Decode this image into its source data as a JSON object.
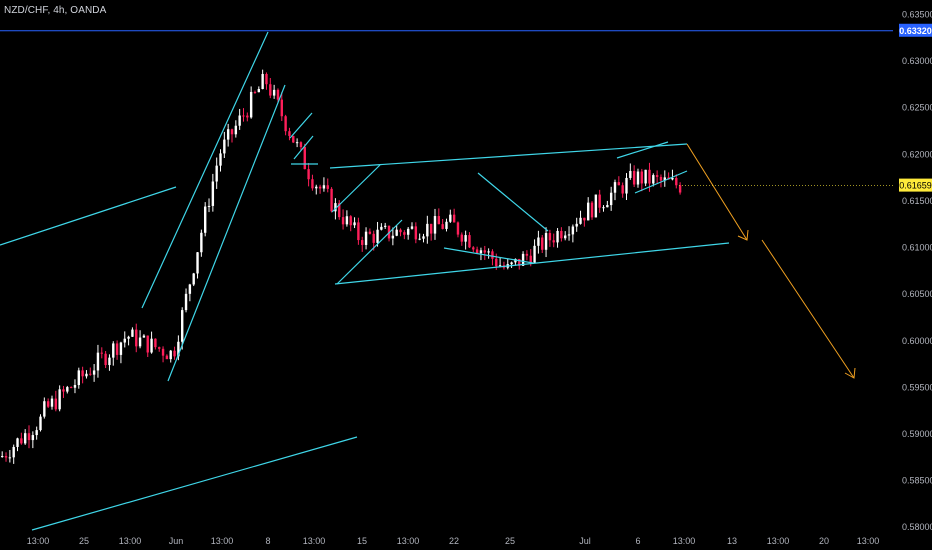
{
  "header": {
    "symbol": "NZD/CHF, 4h, OANDA"
  },
  "colors": {
    "background": "#000000",
    "up_candle": "#ffffff",
    "down_candle": "#ff1f5a",
    "pattern_lines": "#3fd6e8",
    "horizontal_level": "#2962ff",
    "projection_arrow": "#f0a020",
    "axis_text": "#b2b5be",
    "last_price_bg": "#ffeb3b"
  },
  "chart_data": {
    "type": "candlestick",
    "ylim": [
      0.5775,
      0.6365
    ],
    "y_ticks": [
      "0.63500",
      "0.63000",
      "0.62500",
      "0.62000",
      "0.61500",
      "0.61000",
      "0.60500",
      "0.60000",
      "0.59500",
      "0.59000",
      "0.58500",
      "0.58000"
    ],
    "x_ticks": [
      "13:00",
      "25",
      "13:00",
      "Jun",
      "13:00",
      "8",
      "13:00",
      "15",
      "13:00",
      "22",
      "25",
      "Jul",
      "6",
      "13:00",
      "13",
      "13:00",
      "20",
      "13:00"
    ],
    "horizontal_level": {
      "value": 0.6332,
      "label": "0.63320"
    },
    "last_price": {
      "value": 0.61659,
      "label": "0.61659"
    },
    "candles_checkpoints": [
      {
        "x_label_index": 0,
        "close": 0.5915
      },
      {
        "x_label_index": 2,
        "close": 0.6005
      },
      {
        "x_label_index": 3,
        "close": 0.5985
      },
      {
        "x_label_index": 4,
        "close": 0.62
      },
      {
        "x_label_index": 5,
        "close": 0.628
      },
      {
        "x_label_index": 6,
        "close": 0.6175
      },
      {
        "x_label_index": 7,
        "close": 0.611
      },
      {
        "x_label_index": 9,
        "close": 0.6125
      },
      {
        "x_label_index": 10,
        "close": 0.6075
      },
      {
        "x_label_index": 11,
        "close": 0.6135
      },
      {
        "x_label_index": 12,
        "close": 0.6175
      },
      {
        "x_label_index": 13,
        "close": 0.6166
      }
    ],
    "annotations": {
      "channel_upper": {
        "from": [
          "May 27 13:00",
          0.602
        ],
        "to": [
          "Jun 5 09:00",
          0.633
        ]
      },
      "channel_lower": {
        "from": [
          "May 29 05:00",
          0.5935
        ],
        "to": [
          "Jun 5 17:00",
          0.627
        ]
      },
      "range_top": {
        "from": [
          "Jun 10 09:00",
          0.6175
        ],
        "to": [
          "Jul 8 09:00",
          0.6197
        ]
      },
      "range_bottom": {
        "from": [
          "Jun 10 09:00",
          0.604
        ],
        "to": [
          "Jul 10 09:00",
          0.6085
        ]
      },
      "projection": {
        "from": [
          "Jul 8 09:00",
          0.6197
        ],
        "via": [
          "Jul 12 09:00",
          0.6105
        ],
        "to": [
          "Jul 17 09:00",
          0.5935
        ]
      }
    }
  }
}
